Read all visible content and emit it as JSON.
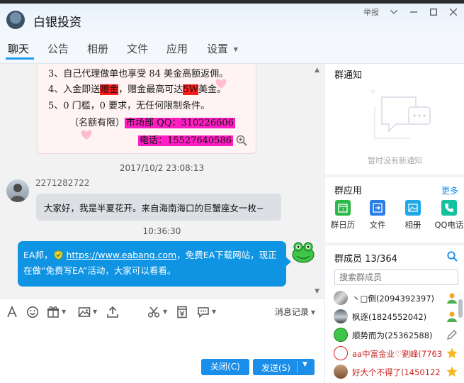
{
  "window": {
    "title": "白银投资",
    "report_label": "举报",
    "colors": {
      "accent": "#1a8ee8",
      "bubble_self": "#0f94e4",
      "poster_pink": "#ff1ec4",
      "poster_red": "#ff1a1a"
    }
  },
  "tabs": [
    {
      "label": "聊天",
      "active": true
    },
    {
      "label": "公告"
    },
    {
      "label": "相册"
    },
    {
      "label": "文件"
    },
    {
      "label": "应用"
    },
    {
      "label": "设置",
      "has_dropdown": true
    }
  ],
  "chat": {
    "poster": {
      "line3": "3、自己代理做单也享受 84 美金高额返佣。",
      "line4_a": "4、入金即送",
      "line4_b": "赠金",
      "line4_c": "，赠金最高可达",
      "line4_d": "5W",
      "line4_e": "美金。",
      "line5": "5、0 门槛，0 要求，无任何限制条件。",
      "line6_a": "（名额有限）",
      "line6_b": "市场部 QQ：310226606",
      "line7": "电话：15527640586"
    },
    "messages": [
      {
        "timestamp": "2017/10/2 23:08:13",
        "sender": "2271282722",
        "text": "大家好，我是半夏花开。来自海南海口的巨蟹座女一枚~"
      },
      {
        "timestamp": "10:36:30",
        "text_a": "EA邦，",
        "link": "https://www.eabang.com",
        "text_b": "，免费EA下载网站，现正",
        "text_c": "在做“免费写EA”活动，大家可以看看。"
      }
    ]
  },
  "toolbar": {
    "icons": [
      "font-icon",
      "emoji-icon",
      "gift-icon",
      "image-icon",
      "upload-icon",
      "scissors-icon",
      "red-packet-icon",
      "more-chat-icon"
    ],
    "history_label": "消息记录"
  },
  "buttons": {
    "close": "关闭(C)",
    "send": "发送(S)"
  },
  "notice": {
    "title": "群通知",
    "empty_text": "暂时没有新通知"
  },
  "apps": {
    "title": "群应用",
    "more": "更多",
    "items": [
      {
        "label": "群日历",
        "color": "#2eb84a",
        "icon": "calendar-icon"
      },
      {
        "label": "文件",
        "color": "#2a7ee8",
        "icon": "file-icon"
      },
      {
        "label": "相册",
        "color": "#1fa8e8",
        "icon": "photo-icon"
      },
      {
        "label": "QQ电话",
        "color": "#14c2a0",
        "icon": "phone-icon"
      }
    ]
  },
  "members": {
    "title": "群成员 13/364",
    "search_placeholder": "搜索群成员",
    "list": [
      {
        "name": "丶□倒(2094392397)",
        "badge": "admin"
      },
      {
        "name": "枫逐(1824552042)",
        "badge": "admin"
      },
      {
        "name": "顺势而为(25362588)",
        "badge": "edit"
      },
      {
        "name": "aa中富金业♡劉峰(7763",
        "badge": "star",
        "red": true
      },
      {
        "name": "好大个不得了(1450122",
        "badge": "star",
        "red": true
      }
    ]
  }
}
